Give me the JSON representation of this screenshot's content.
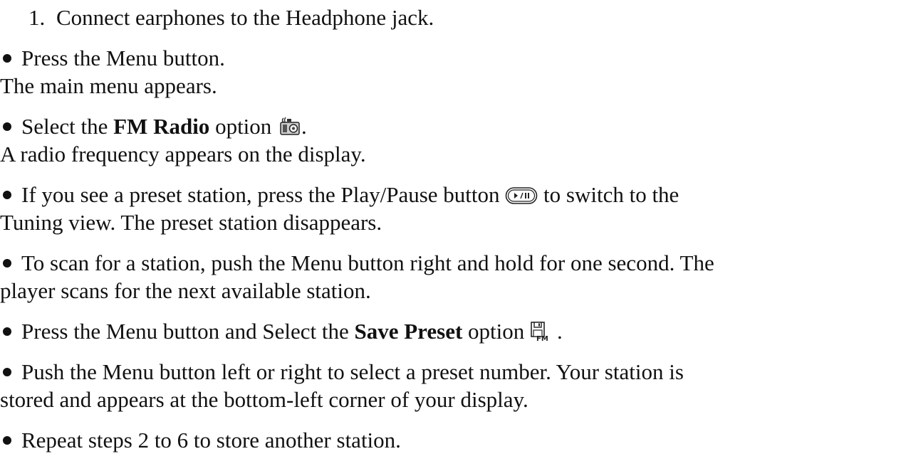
{
  "steps": {
    "s1": {
      "number": "1.",
      "text": "Connect earphones to the Headphone jack."
    },
    "s2": {
      "text": "Press the Menu button.",
      "result": "The main menu appears."
    },
    "s3": {
      "pre": "Select the ",
      "bold": "FM Radio",
      "post": " option ",
      "end": ".",
      "icon": "radio-icon",
      "result": "A radio frequency appears on the display."
    },
    "s4": {
      "pre": "If you see a preset station, press the Play/Pause button ",
      "icon": "play-pause-button-icon",
      "post": " to switch to the",
      "cont": "Tuning view. The preset station disappears."
    },
    "s5": {
      "line1": "To scan for a station, push the Menu button right and hold for one second. The",
      "line2": "player scans for the next available station."
    },
    "s6": {
      "pre": "Press the Menu button and Select the ",
      "bold": "Save Preset",
      "post": " option ",
      "end": ".",
      "icon": "save-preset-fm-icon"
    },
    "s7": {
      "line1": "Push the Menu button left or right to select a preset number. Your station is",
      "line2": "stored and appears at the bottom-left corner of your display."
    },
    "s8": {
      "text": "Repeat steps 2 to 6 to store another station."
    }
  }
}
